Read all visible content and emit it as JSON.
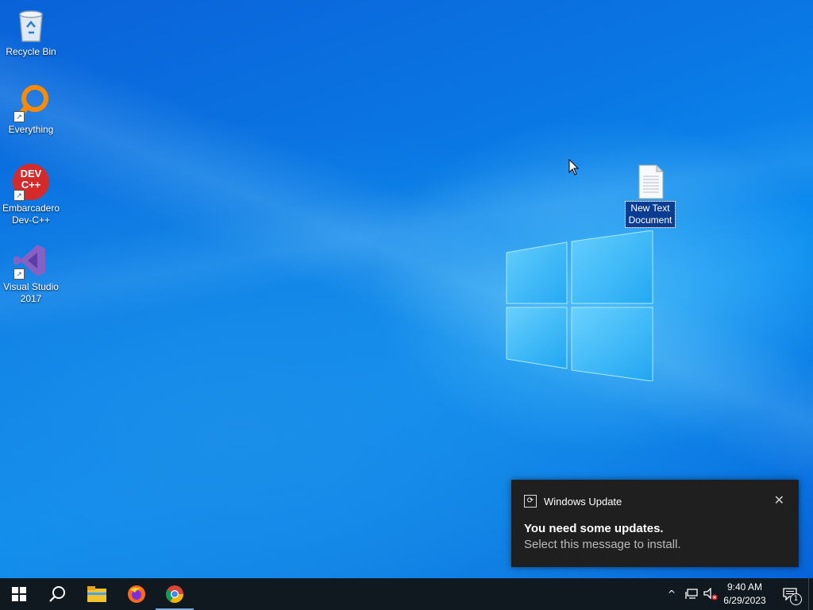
{
  "desktop": {
    "icons": [
      {
        "label": "Recycle Bin",
        "icon": "recycle-bin-icon"
      },
      {
        "label": "Everything",
        "icon": "everything-search-icon"
      },
      {
        "label": "Embarcadero Dev-C++",
        "icon": "devcpp-icon",
        "badge": "DEV C++"
      },
      {
        "label": "Visual Studio 2017",
        "icon": "visual-studio-icon"
      }
    ],
    "selected_file": {
      "label": "New Text Document",
      "icon": "text-document-icon"
    }
  },
  "notification": {
    "app": "Windows Update",
    "title": "You need some updates.",
    "body": "Select this message to install.",
    "close_glyph": "✕"
  },
  "taskbar": {
    "apps": [
      "start-icon",
      "search-icon",
      "file-explorer-icon",
      "firefox-icon",
      "chrome-icon"
    ],
    "tray": {
      "chevron": "^",
      "notification_count": "1"
    },
    "clock": {
      "time": "9:40 AM",
      "date": "6/29/2023"
    }
  },
  "colors": {
    "accent": "#0a78e4",
    "taskbar": "#101820",
    "toast": "#1f1f1f"
  }
}
